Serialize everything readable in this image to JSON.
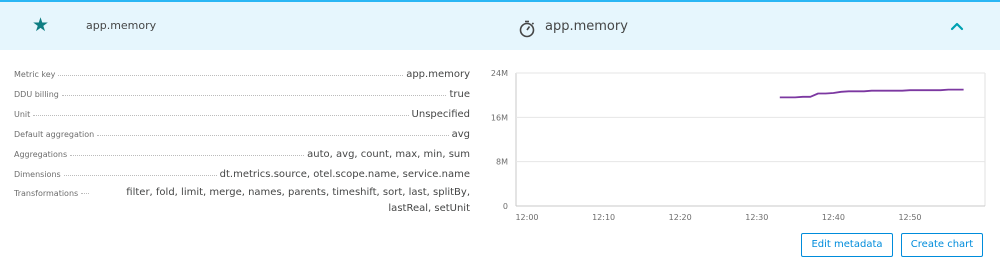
{
  "header": {
    "star_icon": "star-icon",
    "metric_name": "app.memory",
    "title": "app.memory",
    "timer_icon": "stopwatch-icon",
    "collapse_icon": "chevron-up-icon"
  },
  "properties": [
    {
      "key": "Metric key",
      "value": "app.memory"
    },
    {
      "key": "DDU billing",
      "value": "true"
    },
    {
      "key": "Unit",
      "value": "Unspecified"
    },
    {
      "key": "Default aggregation",
      "value": "avg"
    },
    {
      "key": "Aggregations",
      "value": "auto, avg, count, max, min, sum"
    },
    {
      "key": "Dimensions",
      "value": "dt.metrics.source, otel.scope.name, service.name"
    },
    {
      "key": "Transformations",
      "value": "filter, fold, limit, merge, names, parents, timeshift, sort, last, splitBy, lastReal, setUnit"
    }
  ],
  "chart_data": {
    "type": "line",
    "x_ticks": [
      "12:00",
      "12:10",
      "12:20",
      "12:30",
      "12:40",
      "12:50"
    ],
    "y_ticks": [
      "0",
      "8M",
      "16M",
      "24M"
    ],
    "ylim": [
      0,
      24
    ],
    "series": [
      {
        "color": "#7c38a1",
        "x": [
          "12:33",
          "12:34",
          "12:35",
          "12:36",
          "12:37",
          "12:38",
          "12:39",
          "12:40",
          "12:41",
          "12:42",
          "12:43",
          "12:44",
          "12:45",
          "12:46",
          "12:47",
          "12:48",
          "12:49",
          "12:50",
          "12:51",
          "12:52",
          "12:53",
          "12:54",
          "12:55",
          "12:56",
          "12:57"
        ],
        "y": [
          19.6,
          19.6,
          19.6,
          19.7,
          19.7,
          20.3,
          20.3,
          20.4,
          20.6,
          20.7,
          20.7,
          20.7,
          20.8,
          20.8,
          20.8,
          20.8,
          20.8,
          20.9,
          20.9,
          20.9,
          20.9,
          20.9,
          21.0,
          21.0,
          21.0
        ]
      }
    ]
  },
  "actions": {
    "edit_label": "Edit metadata",
    "create_label": "Create chart"
  }
}
